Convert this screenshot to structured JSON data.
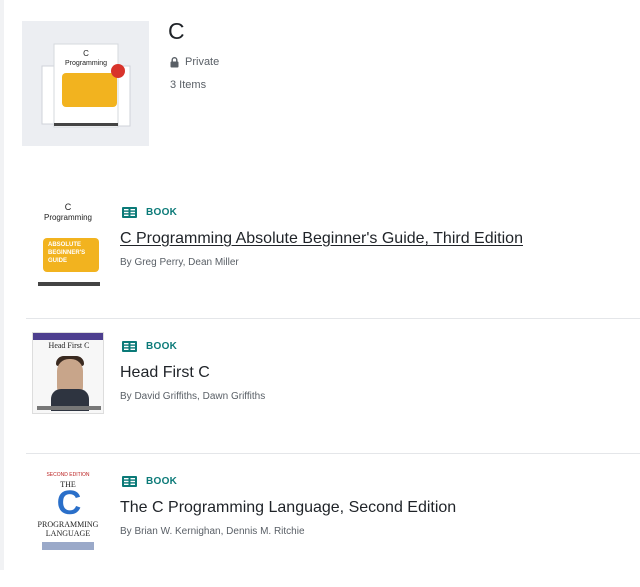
{
  "collection": {
    "title": "C",
    "privacy": "Private",
    "count": "3 Items"
  },
  "items": [
    {
      "type": "BOOK",
      "title": "C Programming Absolute Beginner's Guide, Third Edition",
      "authors": "By Greg Perry, Dean Miller",
      "cover": {
        "letter": "C",
        "subtitle": "Programming",
        "badge": [
          "ABSOLUTE",
          "BEGINNER'S",
          "GUIDE"
        ]
      }
    },
    {
      "type": "BOOK",
      "title": "Head First C",
      "authors": "By David Griffiths, Dawn Griffiths",
      "cover": {
        "title": "Head First C"
      }
    },
    {
      "type": "BOOK",
      "title": "The C Programming Language, Second Edition",
      "authors": "By Brian W. Kernighan, Dennis M. Ritchie",
      "cover": {
        "top": "SECOND EDITION",
        "the": "THE",
        "big": "C",
        "line1": "PROGRAMMING",
        "line2": "LANGUAGE"
      }
    }
  ],
  "colors": {
    "accent": "#0b7a78",
    "text": "#1f2328",
    "muted": "#595f66",
    "badge": "#f2b31f"
  },
  "icons": {
    "lock": "lock-icon",
    "book": "book-icon"
  }
}
